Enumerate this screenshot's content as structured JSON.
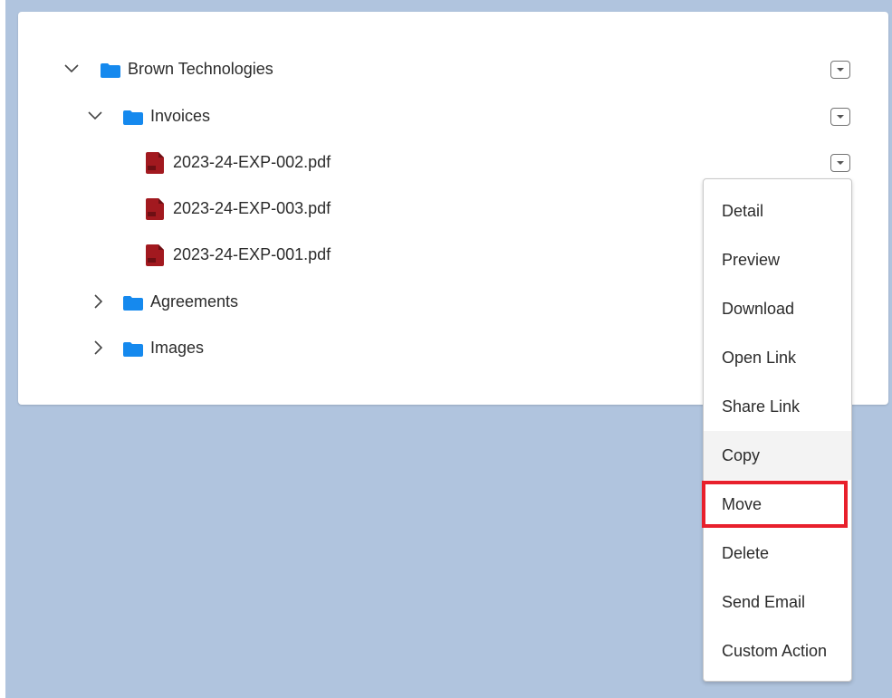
{
  "tree": {
    "root": {
      "label": "Brown Technologies",
      "expanded": true
    },
    "invoices": {
      "label": "Invoices",
      "expanded": true
    },
    "files": [
      {
        "label": "2023-24-EXP-002.pdf"
      },
      {
        "label": "2023-24-EXP-003.pdf"
      },
      {
        "label": "2023-24-EXP-001.pdf"
      }
    ],
    "agreements": {
      "label": "Agreements",
      "expanded": false
    },
    "images": {
      "label": "Images",
      "expanded": false
    }
  },
  "context_menu": {
    "items": [
      {
        "label": "Detail"
      },
      {
        "label": "Preview"
      },
      {
        "label": "Download"
      },
      {
        "label": "Open Link"
      },
      {
        "label": "Share Link"
      },
      {
        "label": "Copy",
        "state": "hovered"
      },
      {
        "label": "Move",
        "state": "highlighted"
      },
      {
        "label": "Delete"
      },
      {
        "label": "Send Email"
      },
      {
        "label": "Custom Action"
      }
    ]
  },
  "colors": {
    "background": "#b0c4de",
    "folder": "#1589ee",
    "pdf": "#a2191f",
    "highlight": "#e8202c"
  },
  "icons": [
    "chevron-down-icon",
    "chevron-right-icon",
    "folder-icon",
    "pdf-icon",
    "dropdown-icon"
  ]
}
